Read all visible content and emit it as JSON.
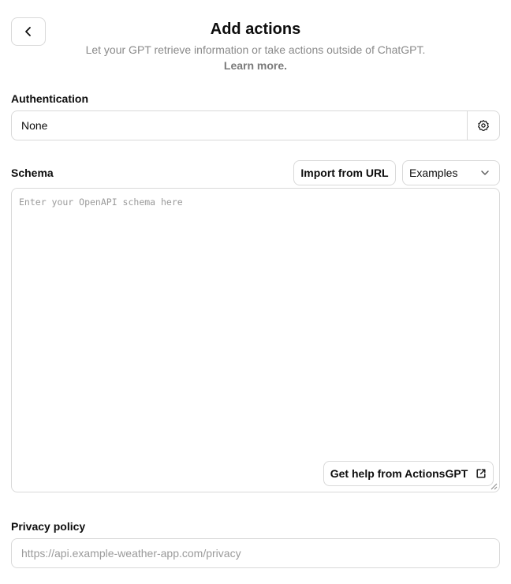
{
  "header": {
    "title": "Add actions",
    "subtitle": "Let your GPT retrieve information or take actions outside of ChatGPT.",
    "learn_more": "Learn more."
  },
  "authentication": {
    "label": "Authentication",
    "value": "None",
    "settings_icon": "gear-icon"
  },
  "schema": {
    "label": "Schema",
    "import_button": "Import from URL",
    "examples_select": "Examples",
    "placeholder": "Enter your OpenAPI schema here",
    "help_button": "Get help from ActionsGPT",
    "help_icon": "external-link-icon"
  },
  "privacy": {
    "label": "Privacy policy",
    "placeholder": "https://api.example-weather-app.com/privacy"
  },
  "icons": {
    "back": "chevron-left-icon",
    "dropdown": "chevron-down-icon"
  }
}
